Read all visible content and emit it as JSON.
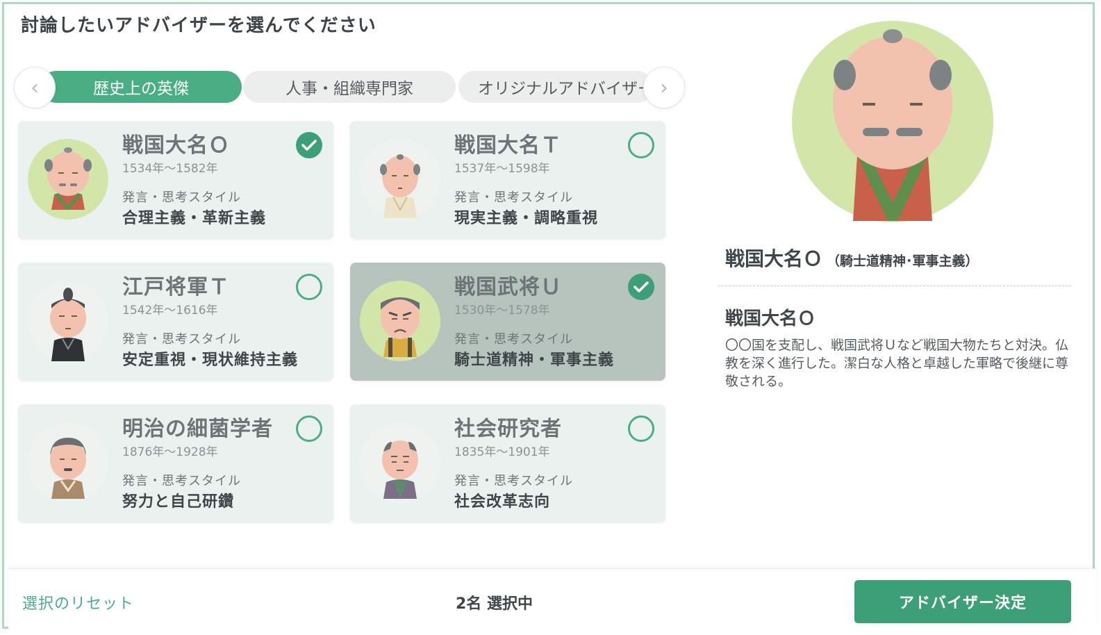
{
  "header": {
    "title": "討論したいアドバイザーを選んでください"
  },
  "tabs": [
    {
      "label": "歴史上の英傑",
      "active": true
    },
    {
      "label": "人事・組織専門家",
      "active": false
    },
    {
      "label": "オリジナルアドバイザー",
      "active": false
    }
  ],
  "cards": [
    {
      "name": "戦国大名Ｏ",
      "years": "1534年～1582年",
      "style_label": "発言・思考スタイル",
      "style": "合理主義・革新主義",
      "selected": true,
      "avatar": "samurai-lord-o"
    },
    {
      "name": "戦国大名Ｔ",
      "years": "1537年～1598年",
      "style_label": "発言・思考スタイル",
      "style": "現実主義・調略重視",
      "selected": false,
      "avatar": "samurai-lord-t"
    },
    {
      "name": "江戸将軍Ｔ",
      "years": "1542年～1616年",
      "style_label": "発言・思考スタイル",
      "style": "安定重視・現状維持主義",
      "selected": false,
      "avatar": "shogun-t"
    },
    {
      "name": "戦国武将Ｕ",
      "years": "1530年～1578年",
      "style_label": "発言・思考スタイル",
      "style": "騎士道精神・軍事主義",
      "selected": true,
      "avatar": "warlord-u"
    },
    {
      "name": "明治の細菌学者",
      "years": "1876年～1928年",
      "style_label": "発言・思考スタイル",
      "style": "努力と自己研鑽",
      "selected": false,
      "avatar": "bacteriologist"
    },
    {
      "name": "社会研究者",
      "years": "1835年～1901年",
      "style_label": "発言・思考スタイル",
      "style": "社会改革志向",
      "selected": false,
      "avatar": "social-researcher"
    }
  ],
  "detail": {
    "heading": "戦国大名Ｏ",
    "heading_sub": "（騎士道精神･軍事主義）",
    "name": "戦国大名Ｏ",
    "description": "〇〇国を支配し、戦国武将Ｕなど戦国大物たちと対決。仏教を深く進行した。潔白な人格と卓越した軍略で後継に尊敬される。"
  },
  "footer": {
    "reset_label": "選択のリセット",
    "count_label": "2名 選択中",
    "decide_label": "アドバイザー決定"
  },
  "colors": {
    "accent": "#4aae85",
    "accent_dark": "#3d9f77",
    "card_bg": "#ebf1ee",
    "card_selected_bg": "#b6c4bd",
    "frame": "#a8dcc1"
  }
}
